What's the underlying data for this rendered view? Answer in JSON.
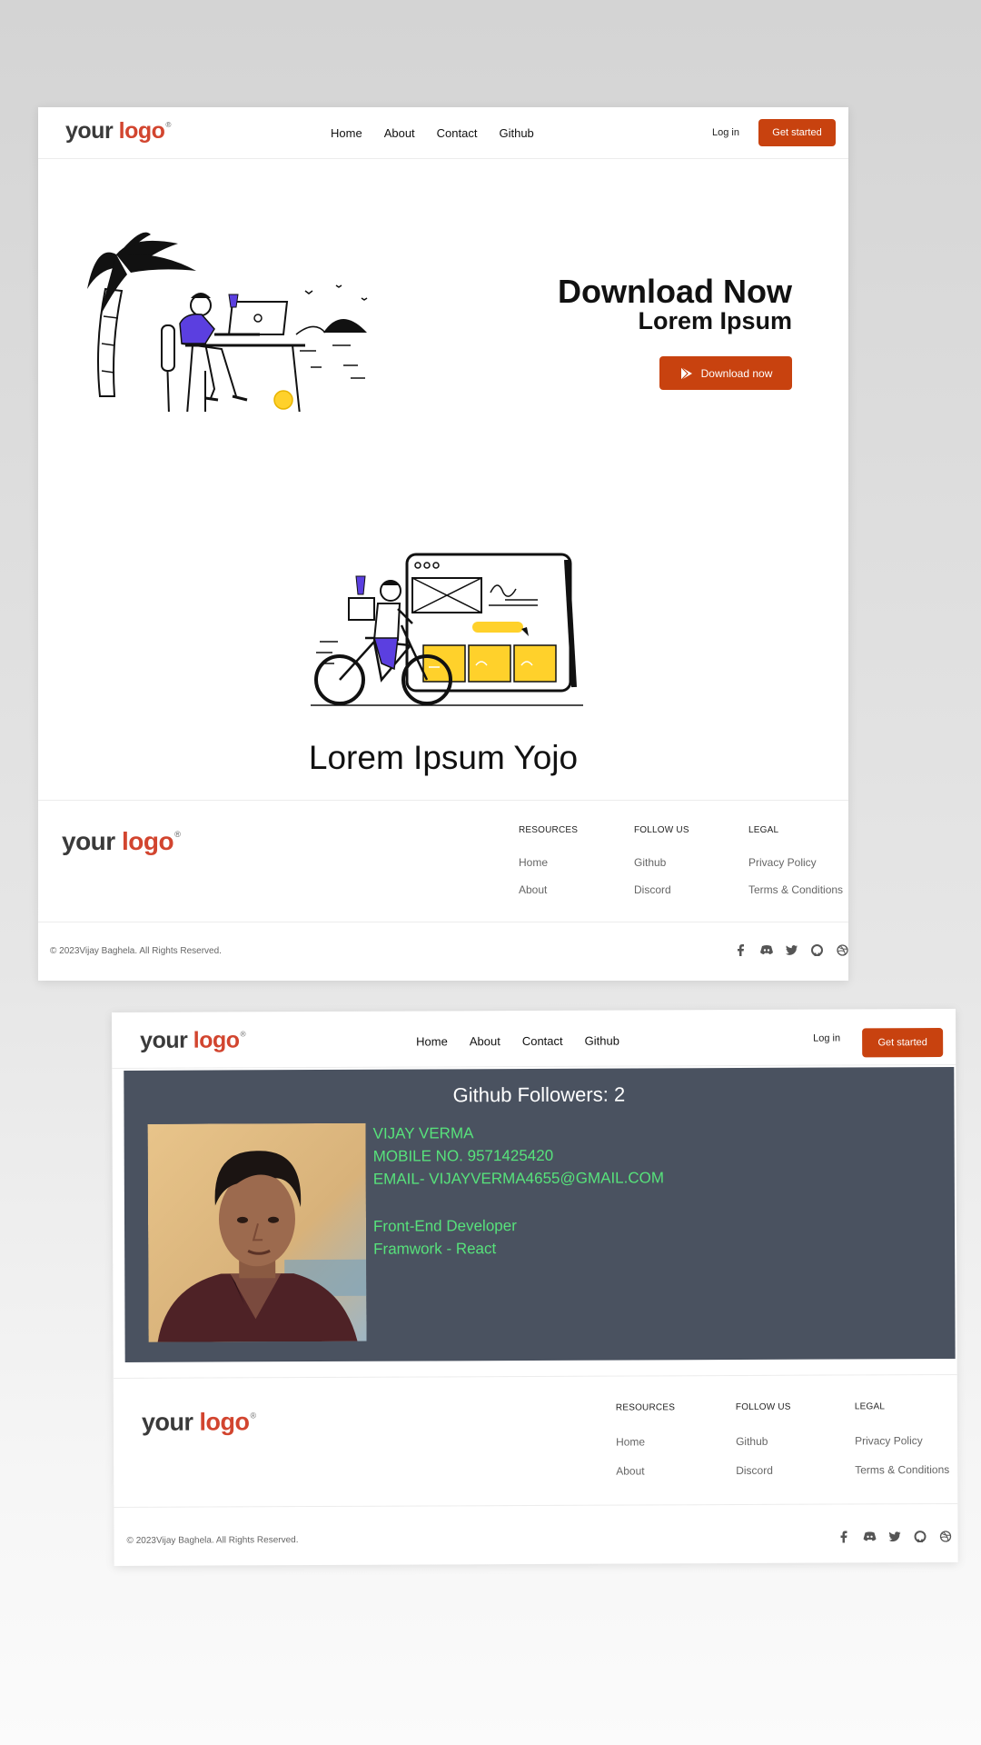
{
  "screen1": {
    "logo": {
      "text1": "your",
      "text2": "logo",
      "mark": "®"
    },
    "nav": [
      "Home",
      "About",
      "Contact",
      "Github"
    ],
    "login": "Log in",
    "cta": "Get started",
    "hero": {
      "title": "Download Now",
      "subtitle": "Lorem Ipsum",
      "button": "Download now",
      "button_icon": "play-store-icon"
    },
    "section_title": "Lorem Ipsum Yojo",
    "footer": {
      "columns": [
        {
          "heading": "RESOURCES",
          "links": [
            "Home",
            "About"
          ]
        },
        {
          "heading": "FOLLOW US",
          "links": [
            "Github",
            "Discord"
          ]
        },
        {
          "heading": "LEGAL",
          "links": [
            "Privacy Policy",
            "Terms & Conditions"
          ]
        }
      ],
      "copyright": "© 2023Vijay Baghela. All Rights Reserved.",
      "socials": [
        "facebook-icon",
        "discord-icon",
        "twitter-icon",
        "github-icon",
        "dribbble-icon"
      ]
    }
  },
  "screen2": {
    "logo": {
      "text1": "your",
      "text2": "logo",
      "mark": "®"
    },
    "nav": [
      "Home",
      "About",
      "Contact",
      "Github"
    ],
    "login": "Log in",
    "cta": "Get started",
    "profile": {
      "followers": "Github Followers: 2",
      "lines": [
        "VIJAY VERMA",
        "MOBILE NO. 9571425420",
        "EMAIL- VIJAYVERMA4655@GMAIL.COM",
        "",
        "Front-End Developer",
        "Framwork - React"
      ]
    },
    "footer": {
      "columns": [
        {
          "heading": "RESOURCES",
          "links": [
            "Home",
            "About"
          ]
        },
        {
          "heading": "FOLLOW US",
          "links": [
            "Github",
            "Discord"
          ]
        },
        {
          "heading": "LEGAL",
          "links": [
            "Privacy Policy",
            "Terms & Conditions"
          ]
        }
      ],
      "copyright": "© 2023Vijay Baghela. All Rights Reserved.",
      "socials": [
        "facebook-icon",
        "discord-icon",
        "twitter-icon",
        "github-icon",
        "dribbble-icon"
      ]
    }
  },
  "colors": {
    "accent": "#c8420f",
    "logo_red": "#d2452f",
    "card_bg": "#4a5260",
    "info_green": "#57e27b"
  }
}
